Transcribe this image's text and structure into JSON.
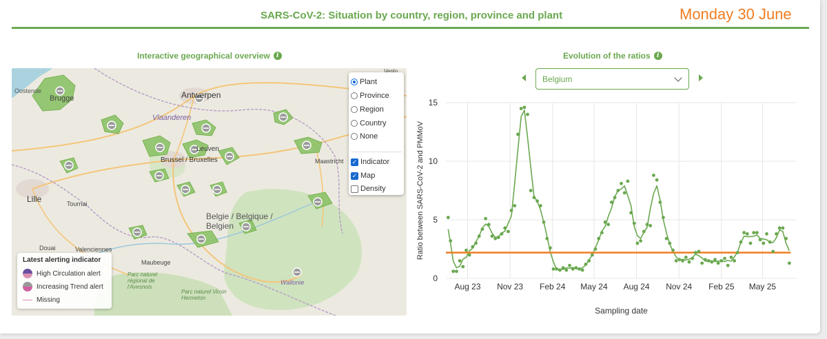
{
  "header": {
    "title": "SARS-CoV-2: Situation by country, region, province and plant",
    "date": "Monday 30 June"
  },
  "map_section": {
    "title": "Interactive geographical overview",
    "place_labels": [
      "Oostende",
      "Brugge",
      "Antwerpen",
      "Vlaanderen",
      "Brussel / Bruxelles",
      "Leuven",
      "Lille",
      "Tournai",
      "Belgie / Belgique / Belgien",
      "Douai",
      "Valenciennes",
      "Maubeuge",
      "Parc naturel régional de l'Avesnois",
      "Parc naturel Viroin Hermeton",
      "Wallonie",
      "Maastricht",
      "Venlo"
    ],
    "layer_control": {
      "levels": [
        "Plant",
        "Province",
        "Region",
        "Country",
        "None"
      ],
      "selected_level": "Plant",
      "overlays": [
        {
          "label": "Indicator",
          "checked": true
        },
        {
          "label": "Map",
          "checked": true
        },
        {
          "label": "Density",
          "checked": false
        }
      ]
    },
    "legend": {
      "title": "Latest alerting indicator",
      "items": [
        {
          "label": "High Circulation alert",
          "color": "#6a4fa0"
        },
        {
          "label": "Increasing Trend alert",
          "color": "#9a9a9a"
        },
        {
          "label": "Missing",
          "color": "#d98fb0"
        }
      ]
    }
  },
  "chart_section": {
    "title": "Evolution of the ratios",
    "selector_value": "Belgium"
  },
  "chart_data": {
    "type": "line",
    "xlabel": "Sampling date",
    "ylabel": "Ratio between SARS-CoV-2 and PMMoV",
    "ylim": [
      0,
      15
    ],
    "yticks": [
      0,
      5,
      10,
      15
    ],
    "xticks": [
      "Aug 23",
      "Nov 23",
      "Feb 24",
      "May 24",
      "Aug 24",
      "Nov 24",
      "Feb 25",
      "May 25"
    ],
    "grid": true,
    "threshold": {
      "value": 2.2,
      "color": "#f07d22"
    },
    "line_color": "#6aa84f",
    "x_start": "2023-06-15",
    "series_points": [
      [
        "2023-06-20",
        5.2
      ],
      [
        "2023-06-25",
        3.2
      ],
      [
        "2023-07-01",
        0.6
      ],
      [
        "2023-07-08",
        0.6
      ],
      [
        "2023-07-15",
        1.5
      ],
      [
        "2023-07-22",
        1.0
      ],
      [
        "2023-07-29",
        2.4
      ],
      [
        "2023-08-05",
        2.0
      ],
      [
        "2023-08-12",
        2.7
      ],
      [
        "2023-08-19",
        3.0
      ],
      [
        "2023-08-26",
        3.6
      ],
      [
        "2023-09-02",
        4.2
      ],
      [
        "2023-09-09",
        5.1
      ],
      [
        "2023-09-16",
        4.6
      ],
      [
        "2023-09-23",
        3.6
      ],
      [
        "2023-09-30",
        3.4
      ],
      [
        "2023-10-07",
        3.5
      ],
      [
        "2023-10-14",
        3.8
      ],
      [
        "2023-10-21",
        4.3
      ],
      [
        "2023-10-28",
        4.0
      ],
      [
        "2023-11-04",
        5.8
      ],
      [
        "2023-11-11",
        6.2
      ],
      [
        "2023-11-18",
        12.3
      ],
      [
        "2023-11-25",
        14.5
      ],
      [
        "2023-12-02",
        14.6
      ],
      [
        "2023-12-09",
        14.0
      ],
      [
        "2023-12-16",
        7.5
      ],
      [
        "2023-12-23",
        6.9
      ],
      [
        "2023-12-30",
        6.6
      ],
      [
        "2024-01-06",
        6.2
      ],
      [
        "2024-01-13",
        4.8
      ],
      [
        "2024-01-20",
        3.4
      ],
      [
        "2024-01-27",
        2.6
      ],
      [
        "2024-02-03",
        0.8
      ],
      [
        "2024-02-10",
        0.8
      ],
      [
        "2024-02-17",
        0.7
      ],
      [
        "2024-02-24",
        0.9
      ],
      [
        "2024-03-02",
        0.7
      ],
      [
        "2024-03-09",
        1.1
      ],
      [
        "2024-03-16",
        0.8
      ],
      [
        "2024-03-23",
        0.9
      ],
      [
        "2024-03-30",
        0.8
      ],
      [
        "2024-04-06",
        0.7
      ],
      [
        "2024-04-13",
        1.2
      ],
      [
        "2024-04-20",
        1.5
      ],
      [
        "2024-04-27",
        2.0
      ],
      [
        "2024-05-04",
        2.5
      ],
      [
        "2024-05-11",
        3.4
      ],
      [
        "2024-05-18",
        3.9
      ],
      [
        "2024-05-25",
        4.8
      ],
      [
        "2024-06-01",
        4.6
      ],
      [
        "2024-06-08",
        6.5
      ],
      [
        "2024-06-15",
        6.9
      ],
      [
        "2024-06-22",
        7.5
      ],
      [
        "2024-06-29",
        8.1
      ],
      [
        "2024-07-06",
        7.3
      ],
      [
        "2024-07-13",
        8.3
      ],
      [
        "2024-07-20",
        5.6
      ],
      [
        "2024-07-27",
        4.7
      ],
      [
        "2024-08-03",
        3.0
      ],
      [
        "2024-08-10",
        3.2
      ],
      [
        "2024-08-17",
        4.0
      ],
      [
        "2024-08-24",
        4.6
      ],
      [
        "2024-08-31",
        4.5
      ],
      [
        "2024-09-07",
        8.8
      ],
      [
        "2024-09-14",
        8.4
      ],
      [
        "2024-09-21",
        6.5
      ],
      [
        "2024-09-28",
        5.2
      ],
      [
        "2024-10-05",
        3.4
      ],
      [
        "2024-10-12",
        3.0
      ],
      [
        "2024-10-19",
        2.4
      ],
      [
        "2024-10-26",
        1.5
      ],
      [
        "2024-11-02",
        1.6
      ],
      [
        "2024-11-09",
        1.5
      ],
      [
        "2024-11-16",
        1.8
      ],
      [
        "2024-11-23",
        1.4
      ],
      [
        "2024-11-30",
        1.7
      ],
      [
        "2024-12-07",
        2.2
      ],
      [
        "2024-12-14",
        2.3
      ],
      [
        "2024-12-21",
        1.3
      ],
      [
        "2024-12-28",
        1.6
      ],
      [
        "2025-01-04",
        1.5
      ],
      [
        "2025-01-11",
        1.4
      ],
      [
        "2025-01-18",
        1.6
      ],
      [
        "2025-01-25",
        1.3
      ],
      [
        "2025-02-01",
        1.5
      ],
      [
        "2025-02-08",
        1.7
      ],
      [
        "2025-02-15",
        1.1
      ],
      [
        "2025-02-22",
        1.8
      ],
      [
        "2025-03-01",
        1.5
      ],
      [
        "2025-03-08",
        2.2
      ],
      [
        "2025-03-15",
        3.1
      ],
      [
        "2025-03-22",
        3.9
      ],
      [
        "2025-03-29",
        3.8
      ],
      [
        "2025-04-05",
        3.0
      ],
      [
        "2025-04-12",
        3.9
      ],
      [
        "2025-04-19",
        3.9
      ],
      [
        "2025-04-26",
        3.3
      ],
      [
        "2025-05-03",
        3.0
      ],
      [
        "2025-05-10",
        3.8
      ],
      [
        "2025-05-17",
        3.1
      ],
      [
        "2025-05-24",
        2.3
      ],
      [
        "2025-05-31",
        3.8
      ],
      [
        "2025-06-07",
        4.3
      ],
      [
        "2025-06-14",
        4.3
      ],
      [
        "2025-06-21",
        3.4
      ],
      [
        "2025-06-28",
        1.3
      ]
    ]
  }
}
